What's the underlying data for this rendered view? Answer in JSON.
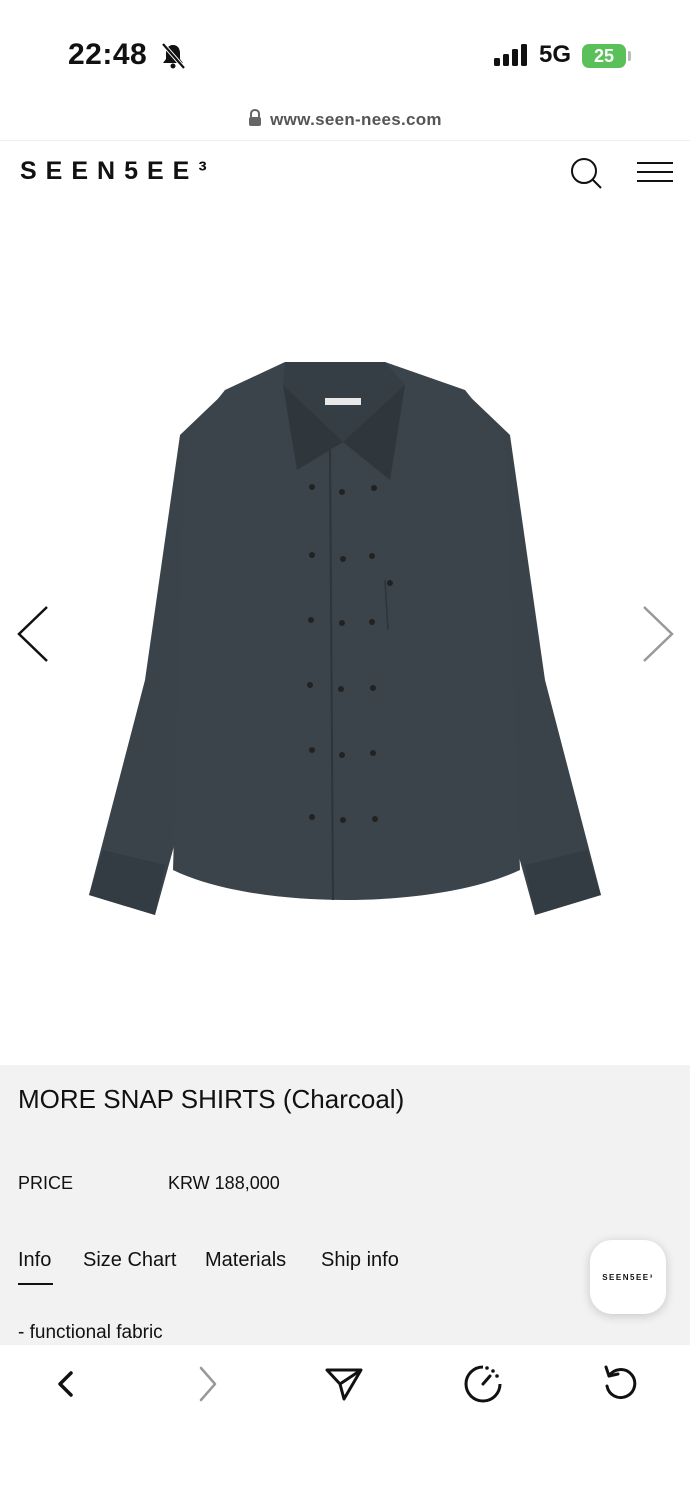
{
  "status": {
    "time": "22:48",
    "network": "5G",
    "battery": "25"
  },
  "browser": {
    "url": "www.seen-nees.com"
  },
  "header": {
    "logo": "SEEN5EE³"
  },
  "product": {
    "title": "MORE SNAP SHIRTS (Charcoal)",
    "price_label": "PRICE",
    "price_value": "KRW 188,000",
    "image_color": "#3a434a"
  },
  "tabs": [
    {
      "label": "Info",
      "active": true
    },
    {
      "label": "Size Chart",
      "active": false
    },
    {
      "label": "Materials",
      "active": false
    },
    {
      "label": "Ship info",
      "active": false
    }
  ],
  "details": {
    "line1": "- functional fabric"
  },
  "floating": {
    "logo": "SEEN5EE³"
  },
  "toolbar": {
    "icons": [
      "back-icon",
      "forward-icon",
      "share-icon",
      "speed-icon",
      "reload-icon"
    ]
  }
}
